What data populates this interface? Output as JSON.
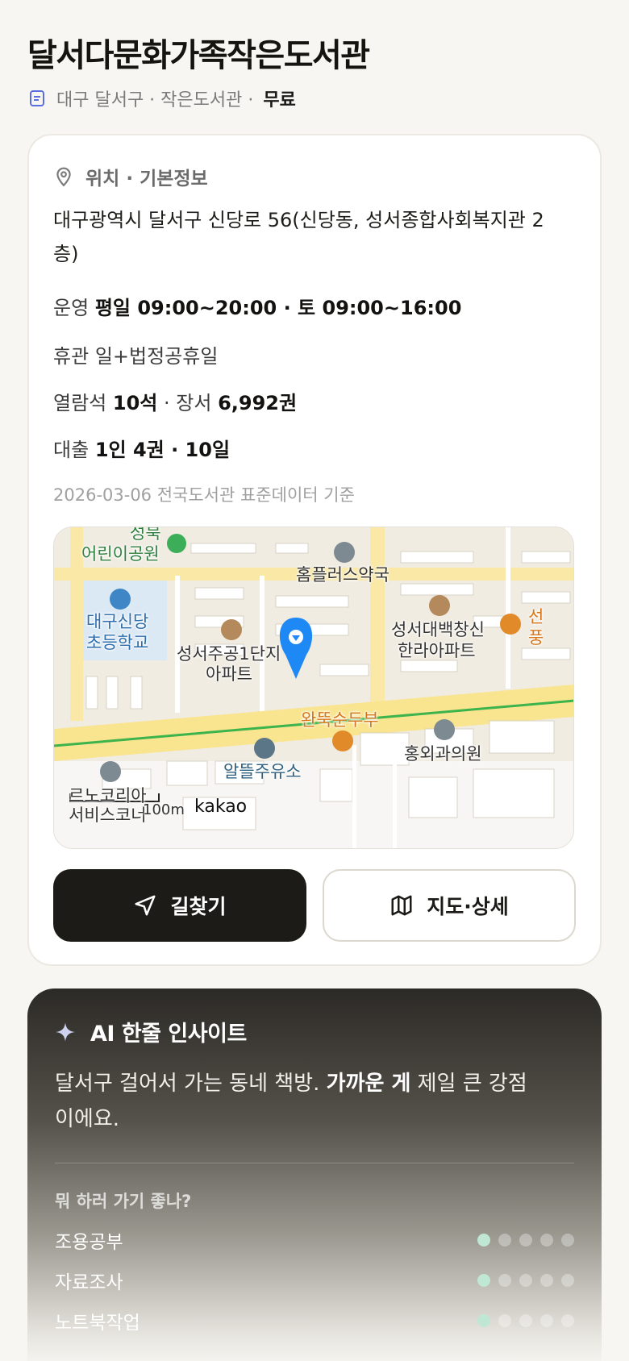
{
  "library": {
    "name": "달서다문화가족작은도서관",
    "meta_prefix": "대구 달서구 · 작은도서관 ·",
    "price": "무료"
  },
  "info": {
    "section_title": "위치 · 기본정보",
    "address": "대구광역시 달서구 신당로 56(신당동, 성서종합사회복지관 2층)",
    "hours_label": "운영",
    "hours_value": "평일 09:00~20:00 · 토 09:00~16:00",
    "closed_label": "휴관",
    "closed_value": "일+법정공휴일",
    "seats_label": "열람석",
    "seats_value": "10석",
    "books_sep": "· 장서",
    "books_value": "6,992권",
    "loan_label": "대출",
    "loan_value": "1인 4권 · 10일",
    "source_note": "2026-03-06 전국도서관 표준데이터 기준"
  },
  "map": {
    "labels": {
      "park": "어린이공원",
      "park_top": "성북",
      "pharmacy": "홈플러스약국",
      "school_1": "대구신당",
      "school_2": "초등학교",
      "apt1_1": "성서주공1단지",
      "apt1_2": "아파트",
      "apt2_1": "성서대백창신",
      "apt2_2": "한라아파트",
      "restaurant": "완뚝순두부",
      "clinic": "홍외과의원",
      "gas": "알뜰주유소",
      "service_1": "르노코리아",
      "service_2": "서비스코너",
      "scale": "100m",
      "brand": "kakao",
      "edge_1": "선",
      "edge_2": "풍"
    },
    "colors": {
      "road_main": "#f9e48f",
      "road_minor": "#ffffff",
      "route_line": "#3cb44b",
      "pin": "#1e88f5"
    }
  },
  "actions": {
    "directions": "길찾기",
    "map_detail": "지도·상세"
  },
  "ai": {
    "title": "AI 한줄 인사이트",
    "text_before": "달서구 걸어서 가는 동네 책방.",
    "text_bold": "가까운 게",
    "text_after": "제일 큰 강점이에요.",
    "question": "뭐 하러 가기 좋나?",
    "activities": [
      {
        "label": "조용공부",
        "score": 1
      },
      {
        "label": "자료조사",
        "score": 1
      },
      {
        "label": "노트북작업",
        "score": 1
      }
    ],
    "max_score": 5,
    "dot_on_color": "#bfe7d4"
  }
}
